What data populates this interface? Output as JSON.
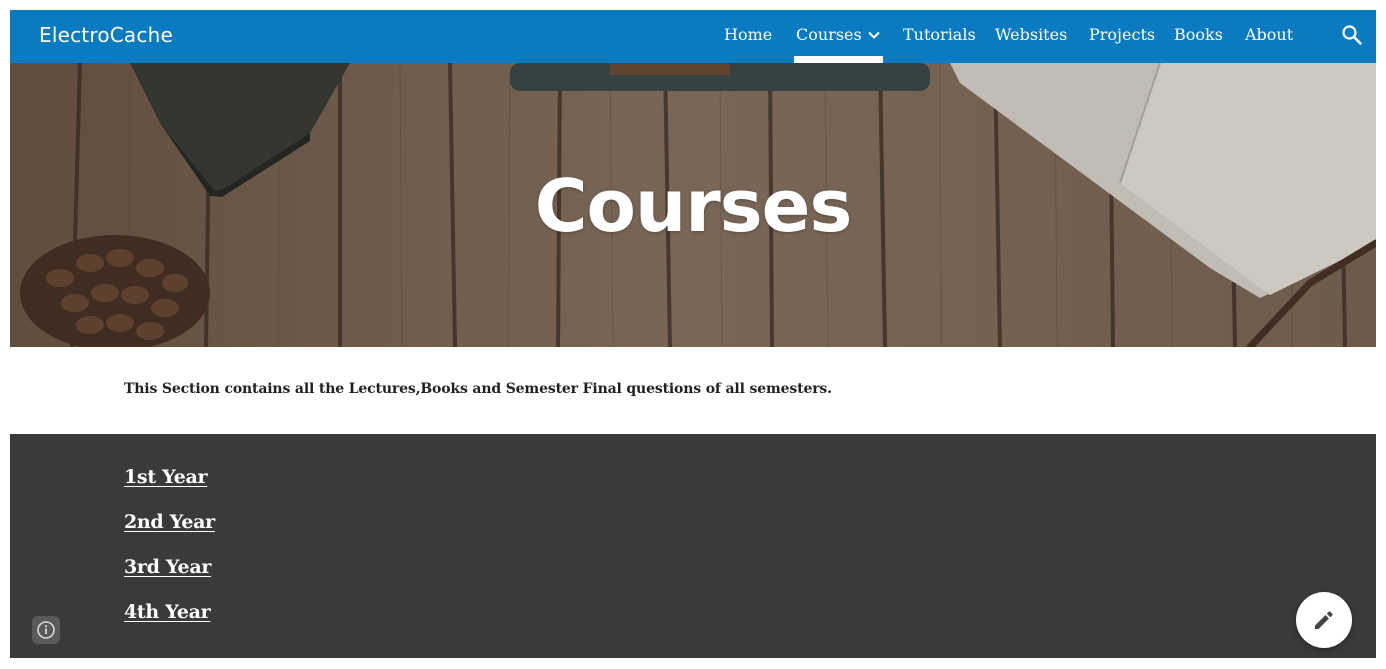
{
  "header": {
    "site_title": "ElectroCache",
    "nav": [
      {
        "label": "Home"
      },
      {
        "label": "Courses",
        "active": true,
        "has_dropdown": true
      },
      {
        "label": "Tutorials"
      },
      {
        "label": "Websites"
      },
      {
        "label": "Projects"
      },
      {
        "label": "Books"
      },
      {
        "label": "About"
      }
    ],
    "search_icon": "search-icon"
  },
  "hero": {
    "title": "Courses"
  },
  "intro": {
    "text": "This Section contains all the Lectures,Books and Semester Final questions of all semesters."
  },
  "years": [
    {
      "label": "1st Year"
    },
    {
      "label": "2nd Year"
    },
    {
      "label": "3rd Year"
    },
    {
      "label": "4th Year"
    }
  ],
  "floating": {
    "info_icon": "info-icon",
    "edit_icon": "pencil-icon"
  },
  "colors": {
    "header_bg": "#0a7bc0",
    "dark_section_bg": "#3a3a3a",
    "text_dark": "#212121",
    "white": "#ffffff"
  }
}
